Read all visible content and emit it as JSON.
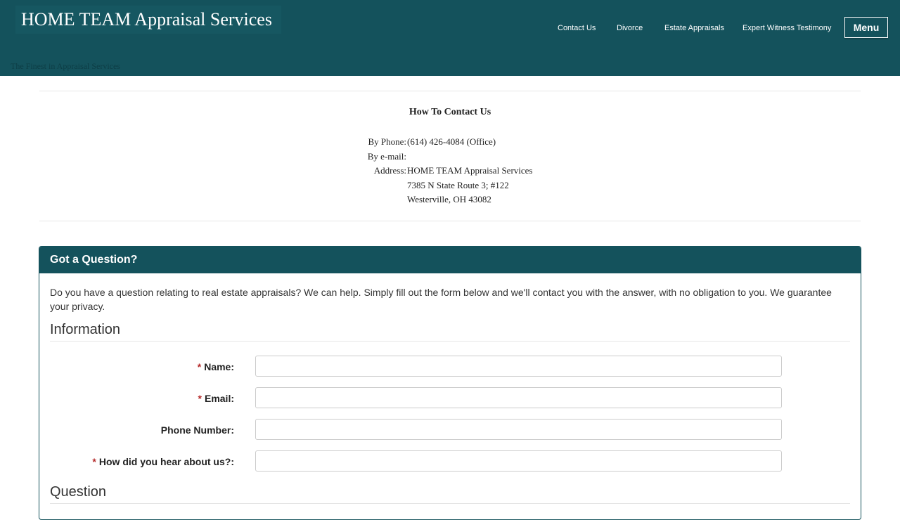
{
  "header": {
    "site_title": "HOME TEAM Appraisal Services",
    "tagline": "The Finest in Appraisal Services",
    "nav": [
      "Contact Us",
      "Divorce",
      "Estate Appraisals",
      "Expert Witness Testimony"
    ],
    "menu_label": "Menu"
  },
  "contact": {
    "title": "How To Contact Us",
    "phone_label": "By Phone:",
    "phone_value": "(614) 426-4084 (Office)",
    "email_label": "By e-mail:",
    "address_label": "Address:",
    "address_lines": [
      "HOME TEAM Appraisal Services",
      "7385 N State Route 3; #122",
      "Westerville, OH  43082"
    ]
  },
  "form": {
    "panel_title": "Got a Question?",
    "intro": "Do you have a question relating to real estate appraisals? We can help. Simply fill out the form below and we'll contact you with the answer, with no obligation to you. We guarantee your privacy.",
    "information_heading": "Information",
    "question_heading": "Question",
    "required_mark": "*",
    "fields": [
      {
        "label": "Name:",
        "value": ""
      },
      {
        "label": "Email:",
        "value": ""
      },
      {
        "label": "Phone Number:",
        "value": ""
      },
      {
        "label": "How did you hear about us?:",
        "value": ""
      }
    ]
  },
  "colors": {
    "brand": "#14525c",
    "required": "#b52a2a"
  }
}
